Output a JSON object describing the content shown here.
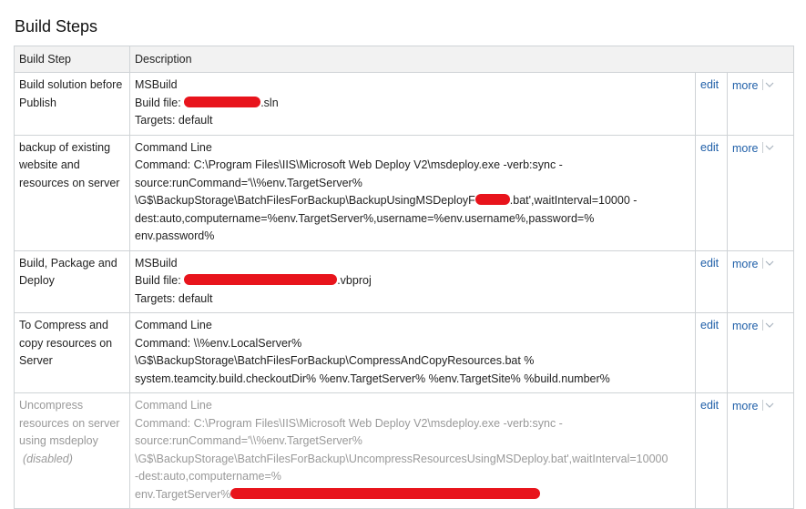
{
  "page": {
    "title": "Build Steps"
  },
  "table": {
    "headers": {
      "step": "Build Step",
      "description": "Description"
    },
    "actions": {
      "edit": "edit",
      "more": "more"
    },
    "rows": [
      {
        "step": "Build solution before Publish",
        "runner": "MSBuild",
        "lines": [
          {
            "prefix": "Build file: ",
            "redacted": true,
            "suffix": ".sln"
          },
          {
            "text": "Targets: default"
          }
        ],
        "disabled": false
      },
      {
        "step": "backup of existing website and resources on server",
        "runner": "Command Line",
        "lines": [
          {
            "text": "Command: C:\\Program Files\\IIS\\Microsoft Web Deploy V2\\msdeploy.exe -verb:sync -"
          },
          {
            "text": "source:runCommand='\\\\%env.TargetServer%"
          },
          {
            "prefix": "\\G$\\BackupStorage\\BatchFilesForBackup\\BackupUsingMSDeployF",
            "redacted": true,
            "suffix": ".bat',waitInterval=10000 -"
          },
          {
            "text": "dest:auto,computername=%env.TargetServer%,username=%env.username%,password=%"
          },
          {
            "text": "env.password%"
          }
        ],
        "disabled": false
      },
      {
        "step": "Build, Package and Deploy",
        "runner": "MSBuild",
        "lines": [
          {
            "prefix": "Build file: ",
            "redacted": true,
            "suffix": ".vbproj"
          },
          {
            "text": "Targets: default"
          }
        ],
        "disabled": false
      },
      {
        "step": "To Compress and copy resources on Server",
        "runner": "Command Line",
        "lines": [
          {
            "text": "Command: \\\\%env.LocalServer%"
          },
          {
            "text": "\\G$\\BackupStorage\\BatchFilesForBackup\\CompressAndCopyResources.bat %"
          },
          {
            "text": "system.teamcity.build.checkoutDir% %env.TargetServer% %env.TargetSite% %build.number%"
          }
        ],
        "disabled": false
      },
      {
        "step": "Uncompress resources on server using msdeploy",
        "disabled_label": "(disabled)",
        "runner": "Command Line",
        "lines": [
          {
            "text": "Command: C:\\Program Files\\IIS\\Microsoft Web Deploy V2\\msdeploy.exe -verb:sync -"
          },
          {
            "text": "source:runCommand='\\\\%env.TargetServer%"
          },
          {
            "text": "\\G$\\BackupStorage\\BatchFilesForBackup\\UncompressResourcesUsingMSDeploy.bat',waitInterval=10000"
          },
          {
            "text": "-dest:auto,computername=%"
          },
          {
            "prefix": "env.TargetServer%",
            "redacted": true,
            "suffix": ""
          }
        ],
        "disabled": true
      }
    ]
  },
  "colors": {
    "link": "#1f5fa8",
    "border": "#cfd3d6",
    "header_bg": "#f2f2f2",
    "disabled_text": "#999999",
    "redaction": "#e8141c"
  },
  "icons": {
    "more_dropdown": "chevron-down-icon"
  }
}
